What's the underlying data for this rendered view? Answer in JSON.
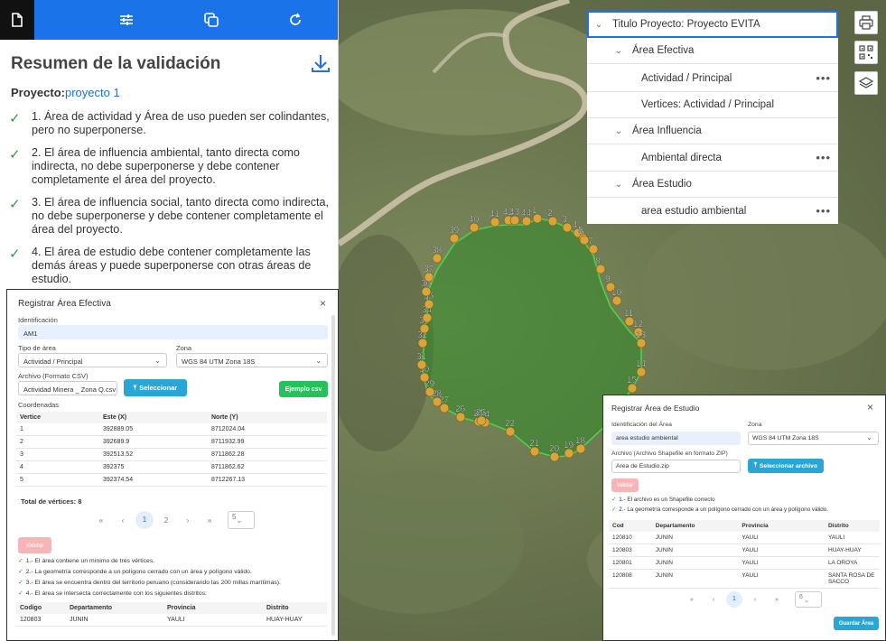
{
  "left_panel": {
    "title": "Resumen de la validación",
    "project_label": "Proyecto:",
    "project_link": "proyecto 1",
    "rules": [
      "1. Área de actividad y Área de uso pueden ser colindantes, pero no superponerse.",
      "2. El área de influencia ambiental, tanto directa como indirecta, no debe superponerse y debe contener completamente el área del proyecto.",
      "3. El área de influencia social, tanto directa como indirecta, no debe superponerse y debe contener completamente el área del proyecto.",
      "4. El área de estudio debe contener completamente las demás áreas y puede superponerse con otras áreas de estudio."
    ],
    "toolbar_icons": [
      "document-icon",
      "sliders-icon",
      "copy-icon",
      "refresh-icon"
    ]
  },
  "modal_efectiva": {
    "title": "Registrar Área Efectiva",
    "close": "×",
    "id_label": "Identificación",
    "id_value": "AM1",
    "tipo_label": "Tipo de área",
    "tipo_value": "Actividad / Principal",
    "zona_label": "Zona",
    "zona_value": "WGS 84 UTM Zona 18S",
    "archivo_label": "Archivo (Formato CSV)",
    "archivo_value": "Actividad Minera _ Zona Q.csv",
    "select_btn": "Seleccionar",
    "ejemplo_btn": "Ejemplo csv",
    "coords_label": "Coordenadas",
    "coords_headers": [
      "Vertice",
      "Este (X)",
      "Norte (Y)"
    ],
    "coords_rows": [
      [
        "1",
        "392889.05",
        "8712024.04"
      ],
      [
        "2",
        "392689.9",
        "8711932.99"
      ],
      [
        "3",
        "392513.52",
        "8711862.28"
      ],
      [
        "4",
        "392375",
        "8711862.62"
      ],
      [
        "5",
        "392374.54",
        "8712267.13"
      ]
    ],
    "total": "Total de vértices: 8",
    "pager": {
      "first": "«",
      "prev": "‹",
      "p1": "1",
      "p2": "2",
      "next": "›",
      "last": "»",
      "size": "5"
    },
    "validar_btn": "Validar",
    "messages": [
      "1.- El área contiene un mínimo de tres vértices.",
      "2.- La geometría corresponde a un polígono cerrado con un área y polígono válido.",
      "3.- El área se encuentra dentro del territorio peruano (considerando las 200 millas marítimas).",
      "4.- El área se intersecta correctamente con los siguientes distritos:"
    ],
    "district_headers": [
      "Codigo",
      "Departamento",
      "Provincia",
      "Distrito"
    ],
    "district_rows": [
      [
        "120803",
        "JUNIN",
        "YAULI",
        "HUAY-HUAY"
      ]
    ]
  },
  "modal_estudio": {
    "title": "Registrar Área de Estudio",
    "close": "×",
    "id_label": "Identificación del Área",
    "id_value": "area estudio ambiental",
    "zona_label": "Zona",
    "zona_value": "WGS 84 UTM Zona 18S",
    "archivo_label": "Archivo (Archivo Shapefile en formato ZIP)",
    "archivo_value": "Area de Estudio.zip",
    "select_btn": "Seleccionar archivo",
    "validar_btn": "Validar",
    "messages": [
      "1.- El archivo es un Shapefile correcto",
      "2.- La geometría corresponde a un polígono cerrado con un área y polígono válido."
    ],
    "headers": [
      "Cod",
      "Departamento",
      "Provincia",
      "Distrito"
    ],
    "rows": [
      [
        "120810",
        "JUNIN",
        "YAULI",
        "YAULI"
      ],
      [
        "120803",
        "JUNIN",
        "YAULI",
        "HUAY-HUAY"
      ],
      [
        "120801",
        "JUNIN",
        "YAULI",
        "LA OROYA"
      ],
      [
        "120808",
        "JUNIN",
        "YAULI",
        "SANTA ROSA DE SACCO"
      ]
    ],
    "pager": {
      "first": "«",
      "prev": "‹",
      "p1": "1",
      "next": "›",
      "last": "»",
      "size": "6"
    },
    "guardar_btn": "Guardar Área"
  },
  "layer_tree": {
    "root": "Titulo Proyecto: Proyecto EVITA",
    "g1": "Área Efectiva",
    "g1_items": [
      "Actividad / Principal",
      "Vertices: Actividad / Principal"
    ],
    "g2": "Área Influencia",
    "g2_items": [
      "Ambiental directa"
    ],
    "g3": "Área Estudio",
    "g3_items": [
      "area estudio ambiental"
    ],
    "more": "•••"
  },
  "map_buttons": [
    "print-icon",
    "qr-icon",
    "layers-icon"
  ],
  "vertex_labels": [
    "1",
    "2",
    "3",
    "4",
    "5",
    "6",
    "7",
    "8",
    "9",
    "10",
    "11",
    "12",
    "13",
    "14",
    "15",
    "18",
    "19",
    "20",
    "21",
    "22",
    "23",
    "24",
    "25",
    "26",
    "27",
    "28",
    "29",
    "30",
    "31",
    "32",
    "33",
    "34",
    "35",
    "36",
    "37",
    "38",
    "39",
    "40",
    "41",
    "42",
    "43",
    "44"
  ],
  "colors": {
    "primary": "#1a73e8",
    "vertex": "#d9a43a",
    "polygon_line": "#4cd24c",
    "check": "#2e9d44"
  }
}
